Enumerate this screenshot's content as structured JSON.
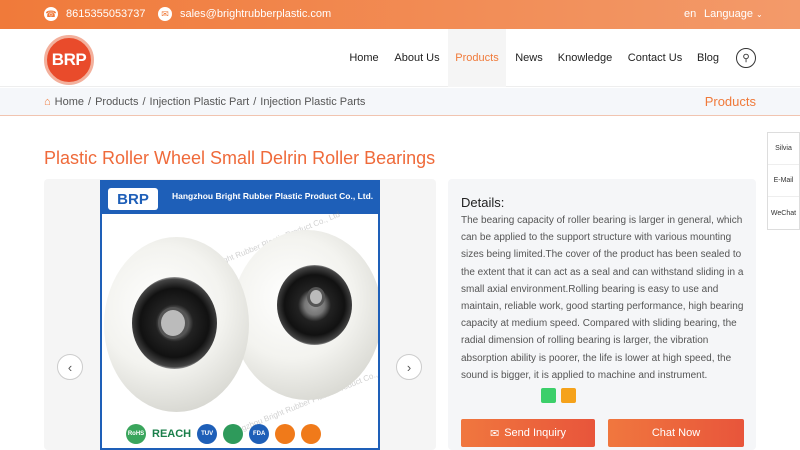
{
  "topbar": {
    "phone": "8615355053737",
    "phone_icon": "phone-icon",
    "email": "sales@brightrubberplastic.com",
    "email_icon": "mail-icon",
    "lang_code": "en",
    "lang_label": "Language"
  },
  "header": {
    "logo_text": "BRP",
    "nav": [
      "Home",
      "About Us",
      "Products",
      "News",
      "Knowledge",
      "Contact Us",
      "Blog"
    ],
    "active_nav": "Products"
  },
  "breadcrumb": {
    "items": [
      "Home",
      "Products",
      "Injection Plastic Part",
      "Injection Plastic Parts"
    ],
    "section": "Products"
  },
  "product": {
    "title": "Plastic Roller Wheel Small Delrin Roller Bearings",
    "image_brand": "BRP",
    "image_company": "Hangzhou Bright Rubber Plastic Product Co., Ltd.",
    "image_watermark": "Hangzhou Bright Rubber Plastic Product Co., Ltd",
    "image_cert_reach": "REACH",
    "image_cert_rohs": "RoHS",
    "image_cert_tuv": "TUV",
    "image_cert_fda": "FDA"
  },
  "details": {
    "heading": "Details:",
    "text": "The bearing capacity of roller bearing is larger in general, which can be applied to the support structure with various mounting sizes being limited.The cover of the product has been sealed to the extent that it can act as a seal and can withstand sliding in a small axial environment.Rolling bearing is easy to use and maintain, reliable work, good starting performance, high bearing capacity at medium speed. Compared with sliding bearing, the radial dimension of rolling bearing is larger, the vibration absorption ability is poorer, the life is lower at high speed, the sound is bigger, it is applied to machine and instrument.",
    "swatches": [
      "#3ccf6a",
      "#f5a21b"
    ],
    "inquiry_label": "Send Inquiry",
    "chat_label": "Chat Now"
  },
  "side_contact": [
    "Silvia",
    "E-Mail",
    "WeChat"
  ]
}
